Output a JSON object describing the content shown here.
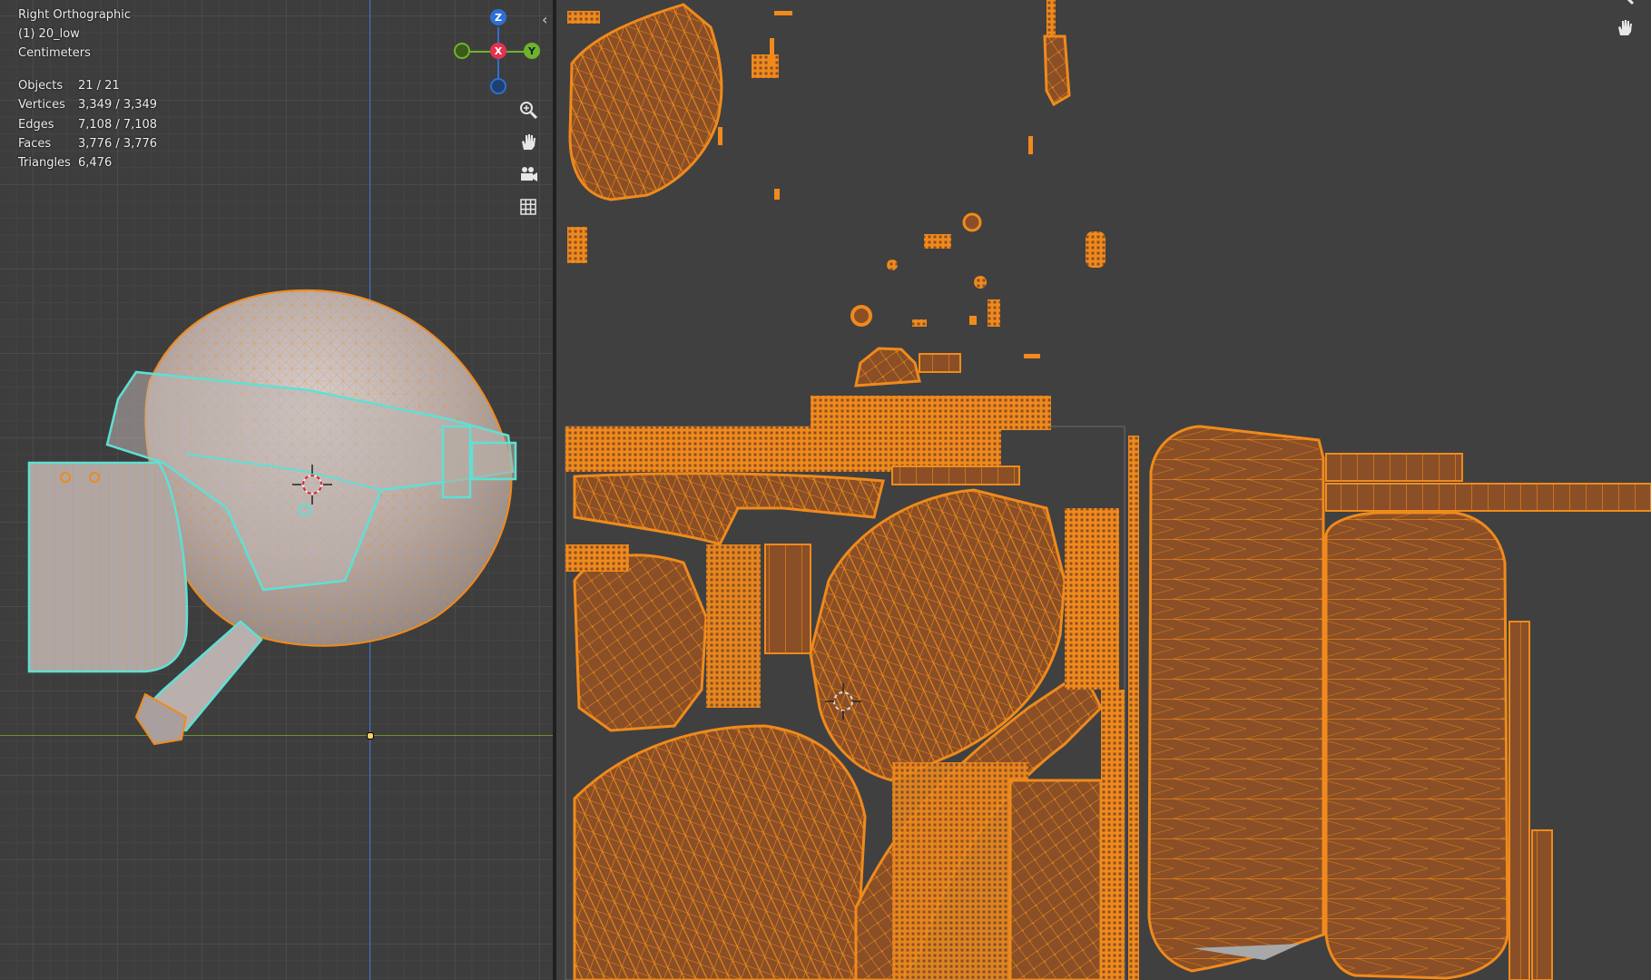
{
  "viewport": {
    "view_name": "Right Orthographic",
    "object_name": "(1) 20_low",
    "units": "Centimeters",
    "stats": [
      {
        "label": "Objects",
        "value": "21 / 21"
      },
      {
        "label": "Vertices",
        "value": "3,349 / 3,349"
      },
      {
        "label": "Edges",
        "value": "7,108 / 7,108"
      },
      {
        "label": "Faces",
        "value": "3,776 / 3,776"
      },
      {
        "label": "Triangles",
        "value": "6,476"
      }
    ],
    "gizmo": {
      "z": "Z",
      "x": "X",
      "y": "Y"
    },
    "nav_icons": [
      "zoom-icon",
      "hand-pan-icon",
      "camera-icon",
      "grid-icon"
    ],
    "collapse_arrow": "‹"
  },
  "uv_editor": {
    "nav_icons": [
      "zoom-icon",
      "hand-pan-icon"
    ]
  },
  "colors": {
    "wire": "#f08a1c",
    "uv_fill": "#8a4f26",
    "selected_wire": "#5fe0d4",
    "background": "#3d3d3d",
    "axis_z": "#2e6fd6",
    "axis_x": "#e23350",
    "axis_y": "#6fb32a"
  }
}
